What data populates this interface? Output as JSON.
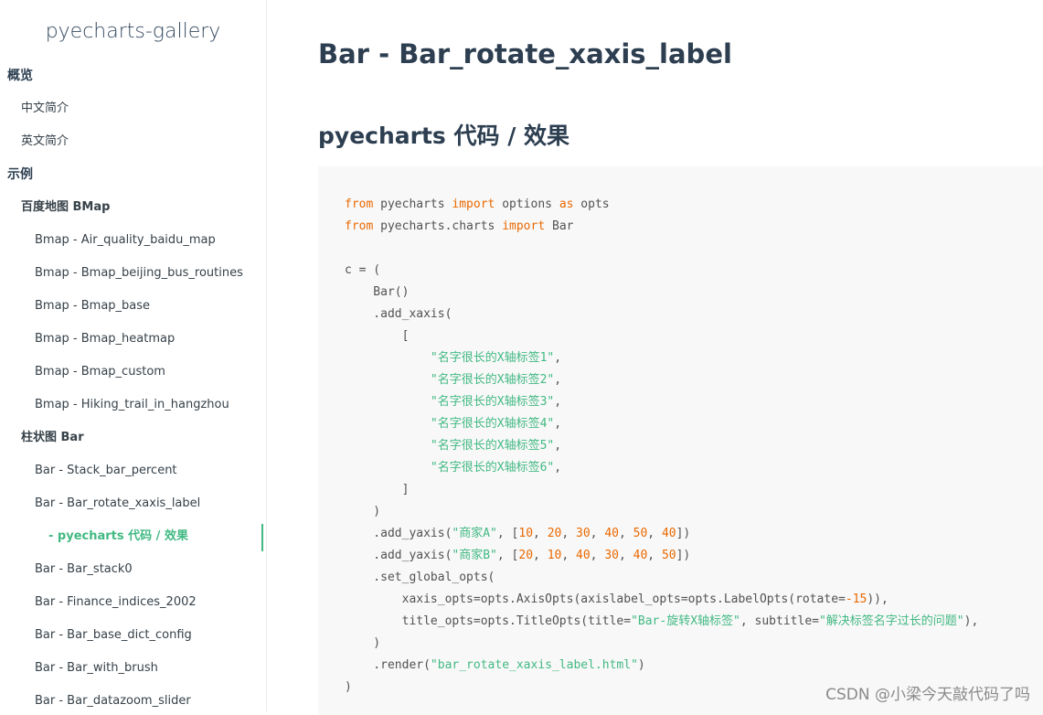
{
  "sidebar": {
    "app_title": "pyecharts-gallery",
    "items": [
      {
        "label": "概览"
      },
      {
        "label": "中文简介"
      },
      {
        "label": "英文简介"
      },
      {
        "label": "示例"
      },
      {
        "label": "百度地图 BMap"
      },
      {
        "label": "Bmap - Air_quality_baidu_map"
      },
      {
        "label": "Bmap - Bmap_beijing_bus_routines"
      },
      {
        "label": "Bmap - Bmap_base"
      },
      {
        "label": "Bmap - Bmap_heatmap"
      },
      {
        "label": "Bmap - Bmap_custom"
      },
      {
        "label": "Bmap - Hiking_trail_in_hangzhou"
      },
      {
        "label": "柱状图 Bar"
      },
      {
        "label": "Bar - Stack_bar_percent"
      },
      {
        "label": "Bar - Bar_rotate_xaxis_label"
      },
      {
        "label": "- pyecharts 代码 / 效果"
      },
      {
        "label": "Bar - Bar_stack0"
      },
      {
        "label": "Bar - Finance_indices_2002"
      },
      {
        "label": "Bar - Bar_base_dict_config"
      },
      {
        "label": "Bar - Bar_with_brush"
      },
      {
        "label": "Bar - Bar_datazoom_slider"
      }
    ]
  },
  "main": {
    "page_title": "Bar - Bar_rotate_xaxis_label",
    "section_title": "pyecharts 代码 / 效果",
    "code": {
      "l1_kw_from": "from",
      "l1_mod": " pyecharts ",
      "l1_kw_import": "import",
      "l1_name": " options ",
      "l1_kw_as": "as",
      "l1_alias": " opts",
      "l2_kw_from": "from",
      "l2_mod": " pyecharts.charts ",
      "l2_kw_import": "import",
      "l2_name": " Bar",
      "l4": "c = (",
      "l5": "    Bar()",
      "l6": "    .add_xaxis(",
      "l7": "        [",
      "labels": [
        "\"名字很长的X轴标签1\"",
        "\"名字很长的X轴标签2\"",
        "\"名字很长的X轴标签3\"",
        "\"名字很长的X轴标签4\"",
        "\"名字很长的X轴标签5\"",
        "\"名字很长的X轴标签6\""
      ],
      "l14": "        ]",
      "l15": "    )",
      "y1_pre": "    .add_yaxis(",
      "y1_str": "\"商家A\"",
      "y1_sep": ", [",
      "y1_vals": [
        "10",
        "20",
        "30",
        "40",
        "50",
        "40"
      ],
      "y1_post": "])",
      "y2_pre": "    .add_yaxis(",
      "y2_str": "\"商家B\"",
      "y2_sep": ", [",
      "y2_vals": [
        "20",
        "10",
        "40",
        "30",
        "40",
        "50"
      ],
      "y2_post": "])",
      "l18": "    .set_global_opts(",
      "l19_pre": "        xaxis_opts=opts.AxisOpts(axislabel_opts=opts.LabelOpts(rotate=",
      "l19_num": "-15",
      "l19_post": ")),",
      "l20_pre": "        title_opts=opts.TitleOpts(title=",
      "l20_str1": "\"Bar-旋转X轴标签\"",
      "l20_mid": ", subtitle=",
      "l20_str2": "\"解决标签名字过长的问题\"",
      "l20_post": "),",
      "l21": "    )",
      "l22_pre": "    .render(",
      "l22_str": "\"bar_rotate_xaxis_label.html\"",
      "l22_post": ")",
      "l23": ")"
    }
  },
  "watermark": "CSDN @小梁今天敲代码了吗",
  "colors": {
    "accent": "#42b983",
    "keyword": "#e96900",
    "code_bg": "#f8f8f8",
    "text": "#2c3e50"
  }
}
